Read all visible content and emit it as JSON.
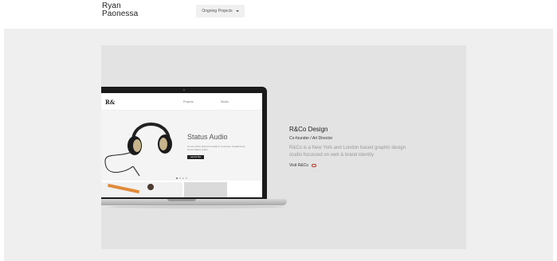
{
  "header": {
    "name_line1": "Ryan",
    "name_line2": "Paonessa",
    "dropdown_label": "Ongoing Projects"
  },
  "screen": {
    "logo": "R&",
    "nav": [
      "Projects",
      "Studio"
    ],
    "hero_title": "Status Audio",
    "hero_desc": "A new online brand for detail in consumer headphones. Iconic Status Audio.",
    "hero_button": "Launch Site"
  },
  "project": {
    "title": "R&Co Design",
    "role": "Co-founder / Art Director",
    "description": "R&Co is a New York and London based graphic design studio focussed on web & brand identity",
    "link_label": "Visit R&Co",
    "link_icon": "link-icon"
  },
  "colors": {
    "band": "#efefef",
    "card": "#e3e3e3",
    "accent": "#c0392b"
  }
}
